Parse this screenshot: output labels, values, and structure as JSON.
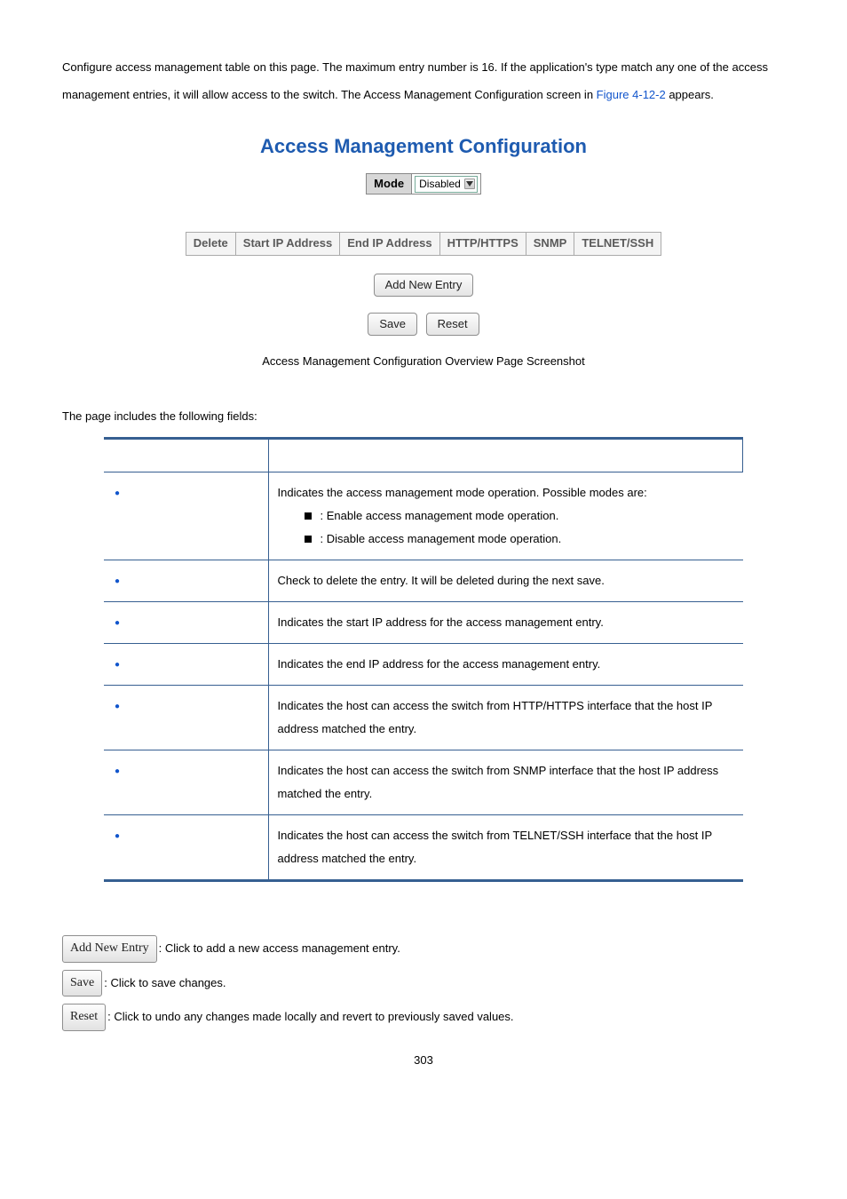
{
  "intro": {
    "p1_a": "Configure access management table on this page. The maximum entry number is 16. If the application's type match any one of the access management entries, it will allow access to the switch. The Access Management Configuration screen in ",
    "figref": "Figure 4-12-2",
    "p1_b": " appears."
  },
  "config": {
    "title": "Access Management Configuration",
    "mode_label": "Mode",
    "mode_value": "Disabled",
    "headers": [
      "Delete",
      "Start IP Address",
      "End IP Address",
      "HTTP/HTTPS",
      "SNMP",
      "TELNET/SSH"
    ],
    "add_btn": "Add New Entry",
    "save_btn": "Save",
    "reset_btn": "Reset"
  },
  "caption": "Access Management Configuration Overview Page Screenshot",
  "fields_intro": "The page includes the following fields:",
  "table": {
    "header_obj": "",
    "header_desc": "",
    "rows": [
      {
        "obj": "",
        "desc_intro": "Indicates the access management mode operation. Possible modes are:",
        "sub": [
          {
            "label": "",
            "text": ": Enable access management mode operation."
          },
          {
            "label": "",
            "text": ": Disable access management mode operation."
          }
        ]
      },
      {
        "obj": "",
        "desc": "Check to delete the entry. It will be deleted during the next save."
      },
      {
        "obj": "",
        "desc": "Indicates the start IP address for the access management entry."
      },
      {
        "obj": "",
        "desc": "Indicates the end IP address for the access management entry."
      },
      {
        "obj": "",
        "desc": "Indicates the host can access the switch from HTTP/HTTPS interface that the host IP address matched the entry."
      },
      {
        "obj": "",
        "desc": "Indicates the host can access the switch from SNMP interface that the host IP address matched the entry."
      },
      {
        "obj": "",
        "desc": "Indicates the host can access the switch from TELNET/SSH interface that the host IP address matched the entry."
      }
    ]
  },
  "buttons": {
    "add": {
      "label": "Add New Entry",
      "text": ": Click to add a new access management entry."
    },
    "save": {
      "label": "Save",
      "text": ": Click to save changes."
    },
    "reset": {
      "label": "Reset",
      "text": ": Click to undo any changes made locally and revert to previously saved values."
    }
  },
  "page_number": "303"
}
